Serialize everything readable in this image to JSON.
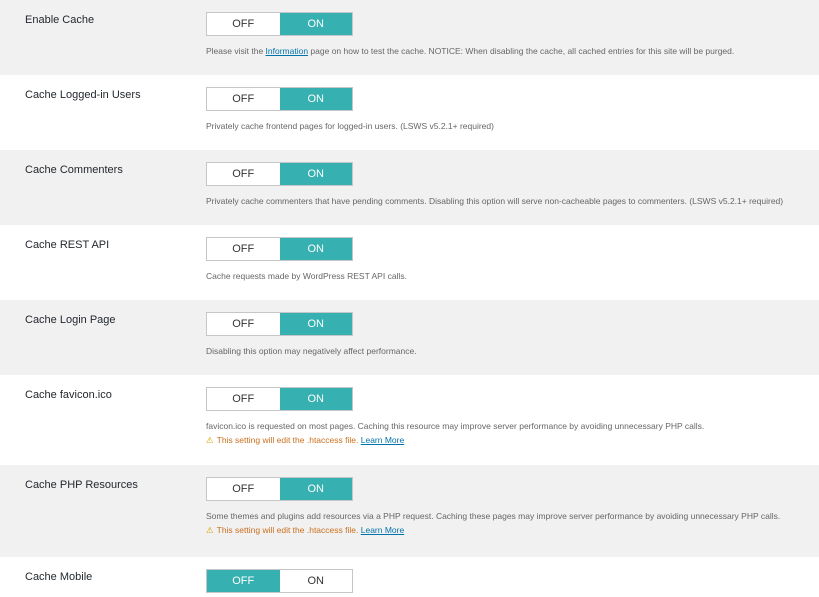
{
  "off_label": "OFF",
  "on_label": "ON",
  "settings": [
    {
      "label": "Enable Cache",
      "state": "on",
      "desc_before": "Please visit the ",
      "desc_link": "Information",
      "desc_after": " page on how to test the cache. NOTICE: When disabling the cache, all cached entries for this site will be purged."
    },
    {
      "label": "Cache Logged-in Users",
      "state": "on",
      "desc": "Privately cache frontend pages for logged-in users. (LSWS v5.2.1+ required)"
    },
    {
      "label": "Cache Commenters",
      "state": "on",
      "desc": "Privately cache commenters that have pending comments. Disabling this option will serve non-cacheable pages to commenters. (LSWS v5.2.1+ required)"
    },
    {
      "label": "Cache REST API",
      "state": "on",
      "desc": "Cache requests made by WordPress REST API calls."
    },
    {
      "label": "Cache Login Page",
      "state": "on",
      "desc": "Disabling this option may negatively affect performance."
    },
    {
      "label": "Cache favicon.ico",
      "state": "on",
      "desc": "favicon.ico is requested on most pages. Caching this resource may improve server performance by avoiding unnecessary PHP calls.",
      "warning": "This setting will edit the .htaccess file.",
      "warning_link": "Learn More"
    },
    {
      "label": "Cache PHP Resources",
      "state": "on",
      "desc": "Some themes and plugins add resources via a PHP request. Caching these pages may improve server performance by avoiding unnecessary PHP calls.",
      "warning": "This setting will edit the .htaccess file.",
      "warning_link": "Learn More"
    },
    {
      "label": "Cache Mobile",
      "state": "off"
    }
  ],
  "colors": {
    "active": "#36b0b0",
    "shaded_row": "#f1f1f1",
    "warning_text": "#ca6f1e",
    "link": "#0073aa"
  },
  "icons": {
    "warning": "warning-triangle-icon"
  }
}
